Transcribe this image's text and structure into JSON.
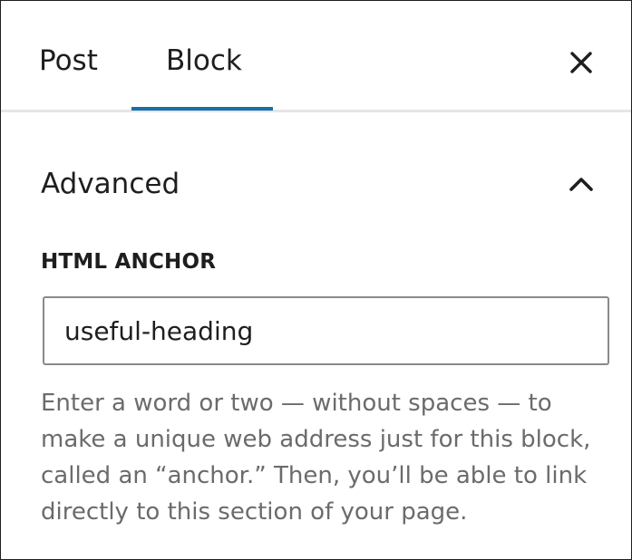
{
  "header": {
    "tabs": [
      {
        "label": "Post",
        "active": false
      },
      {
        "label": "Block",
        "active": true
      }
    ],
    "close_icon": "close-icon",
    "accent_color": "#1a6fa8"
  },
  "panel": {
    "title": "Advanced",
    "expanded": true,
    "toggle_icon": "chevron-up-icon",
    "field": {
      "label": "HTML ANCHOR",
      "value": "useful-heading",
      "help": "Enter a word or two — without spaces — to make a unique web address just for this block, called an “anchor.” Then, you’ll be able to link directly to this section of your page."
    }
  }
}
